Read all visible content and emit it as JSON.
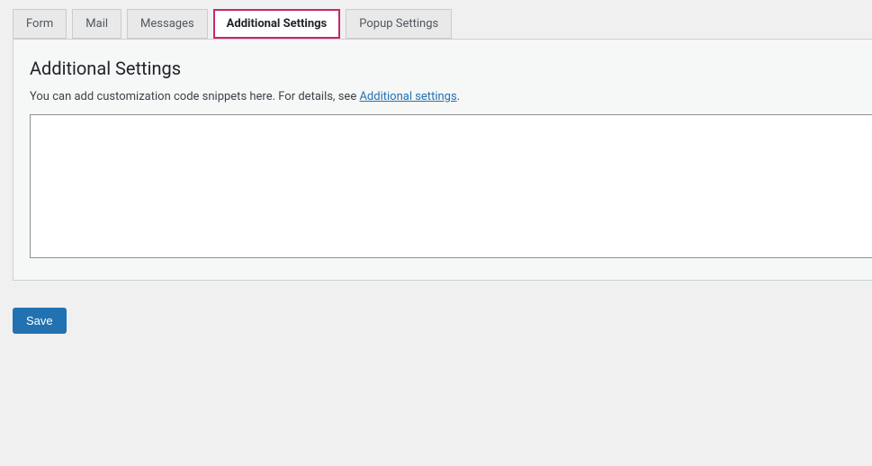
{
  "tabs": [
    {
      "label": "Form"
    },
    {
      "label": "Mail"
    },
    {
      "label": "Messages"
    },
    {
      "label": "Additional Settings"
    },
    {
      "label": "Popup Settings"
    }
  ],
  "panel": {
    "heading": "Additional Settings",
    "desc_prefix": "You can add customization code snippets here. For details, see ",
    "desc_link_text": "Additional settings",
    "desc_suffix": ".",
    "textarea_value": ""
  },
  "actions": {
    "save_label": "Save"
  }
}
